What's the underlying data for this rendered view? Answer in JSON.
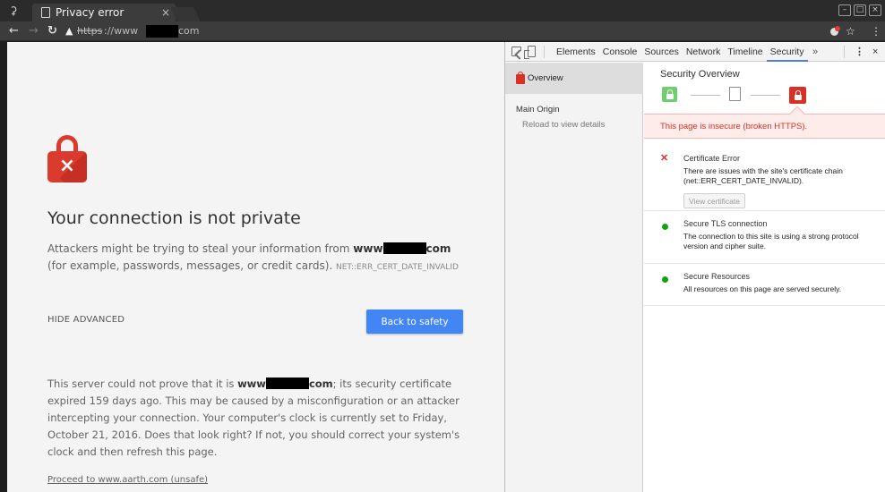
{
  "browser": {
    "tab_title": "Privacy error",
    "tab_close": "×",
    "address": {
      "scheme": "https",
      "prefix": "://www",
      "suffix": "com"
    }
  },
  "page": {
    "heading": "Your connection is not private",
    "desc_part1": "Attackers might be trying to steal your information from ",
    "desc_domain_start": "www",
    "desc_domain_end": "com",
    "desc_part2": " (for example, passwords, messages, or credit cards). ",
    "error_code": "NET::ERR_CERT_DATE_INVALID",
    "hide_advanced": "HIDE ADVANCED",
    "back_button": "Back to safety",
    "details_part1": "This server could not prove that it is ",
    "details_domain_start": "www",
    "details_domain_end": "com",
    "details_part2": "; its security certificate expired 159 days ago. This may be caused by a misconfiguration or an attacker intercepting your connection. Your computer's clock is currently set to Friday, October 21, 2016. Does that look right? If not, you should correct your system's clock and then refresh this page.",
    "proceed_link": "Proceed to www.aarth.com (unsafe)"
  },
  "devtools": {
    "tabs": [
      "Elements",
      "Console",
      "Sources",
      "Network",
      "Timeline",
      "Security"
    ],
    "more": "»",
    "close": "×",
    "sidebar": {
      "overview": "Overview",
      "main_origin": "Main Origin",
      "reload": "Reload to view details"
    },
    "overview": {
      "title": "Security Overview",
      "banner": "This page is insecure (broken HTTPS).",
      "explanations": [
        {
          "status": "error",
          "title": "Certificate Error",
          "text": "There are issues with the site's certificate chain (net::ERR_CERT_DATE_INVALID).",
          "button": "View certificate"
        },
        {
          "status": "secure",
          "title": "Secure TLS connection",
          "text": "The connection to this site is using a strong protocol version and cipher suite."
        },
        {
          "status": "secure",
          "title": "Secure Resources",
          "text": "All resources on this page are served securely."
        }
      ]
    }
  },
  "colors": {
    "lock_red": "#db3a2e",
    "button_blue": "#4285f4",
    "secure_green": "#0ca40c",
    "insecure_red": "#d93025"
  }
}
